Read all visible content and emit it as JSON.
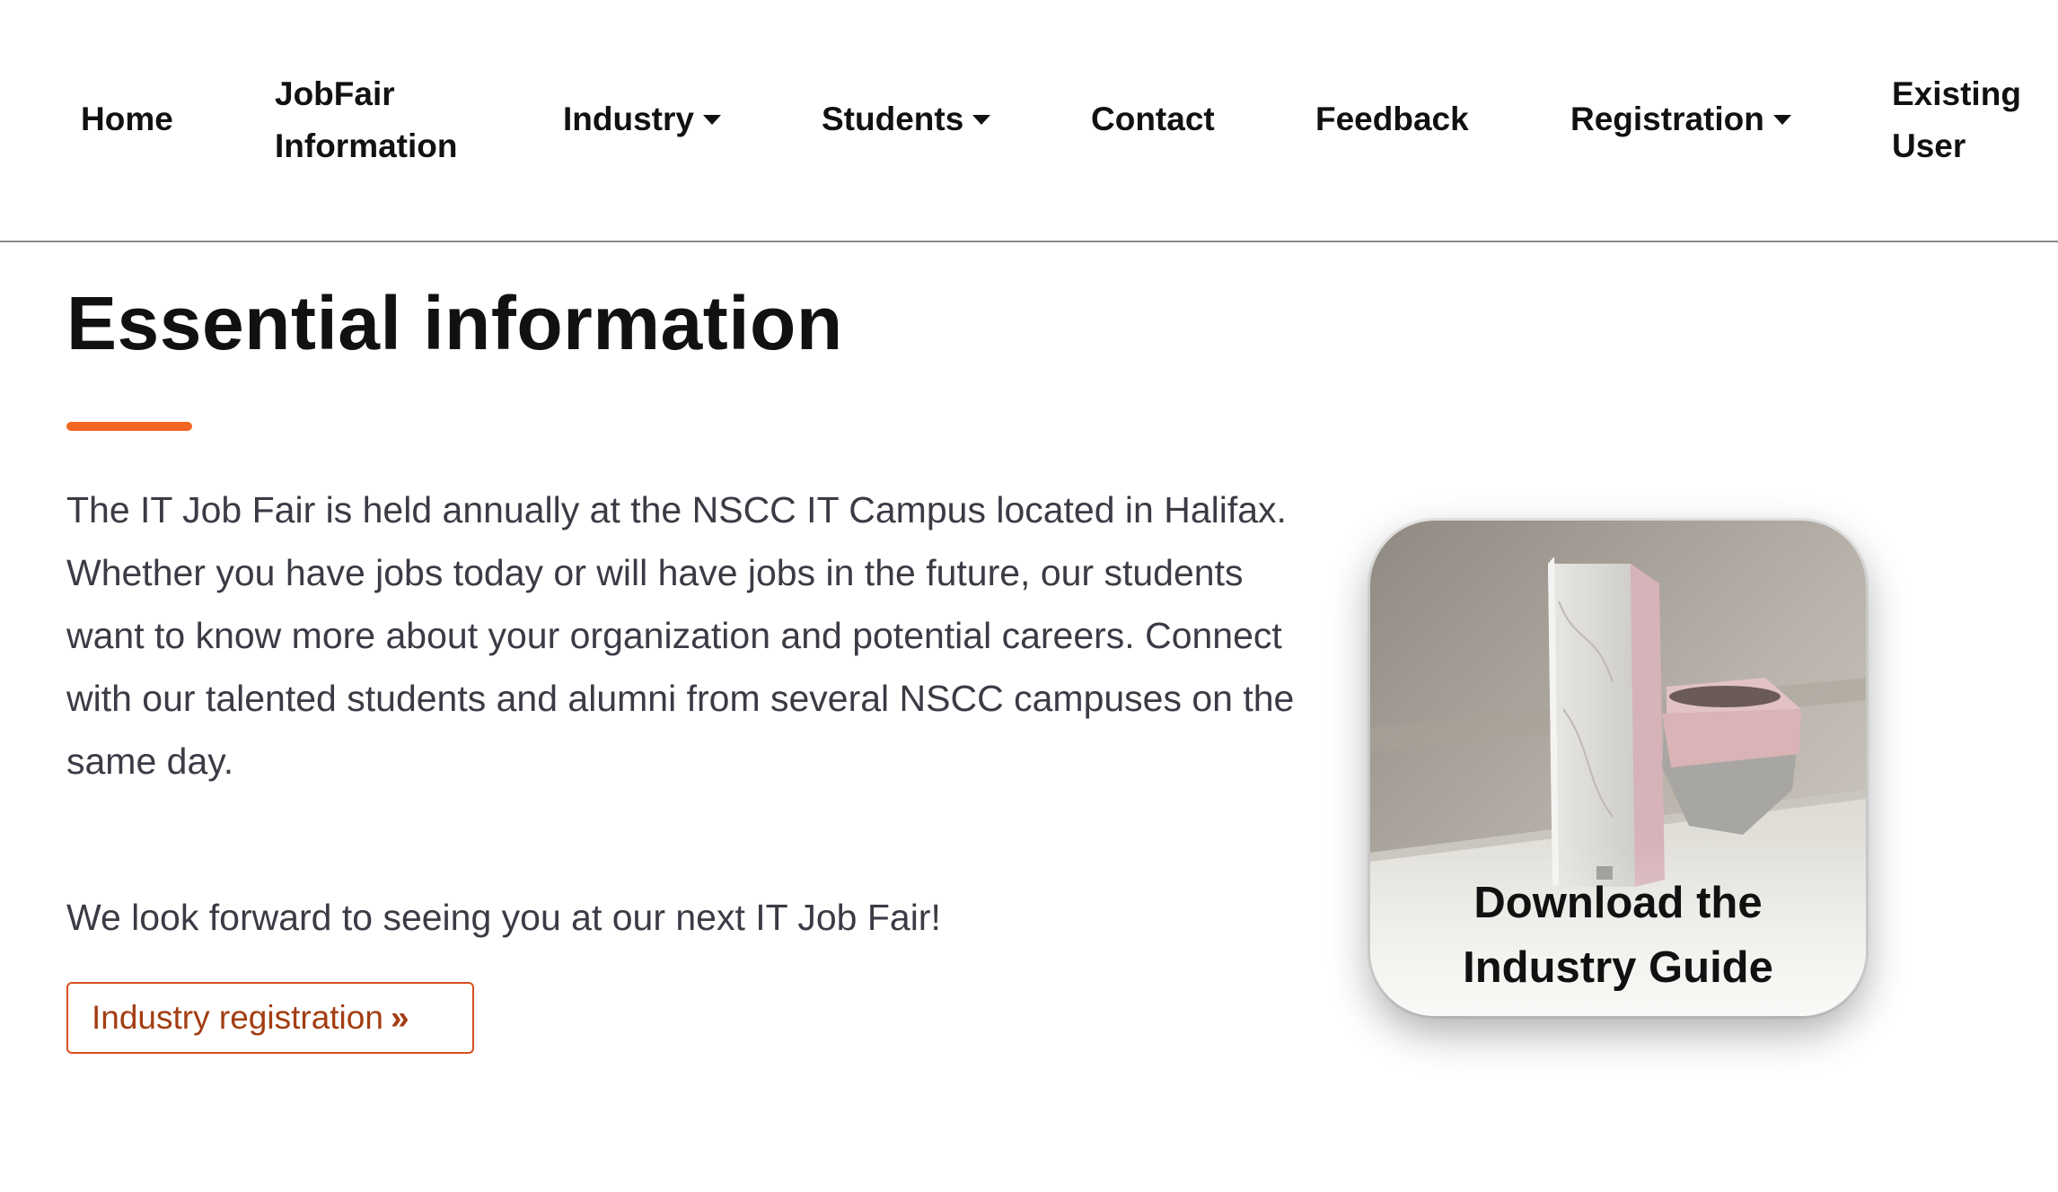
{
  "nav": {
    "home": "Home",
    "jobfair_line1": "JobFair",
    "jobfair_line2": "Information",
    "industry": "Industry",
    "students": "Students",
    "contact": "Contact",
    "feedback": "Feedback",
    "registration": "Registration",
    "existing_line1": "Existing",
    "existing_line2": "User"
  },
  "main": {
    "heading": "Essential information",
    "accent_color": "#f26522",
    "paragraph_1": "The IT Job Fair is held annually at the NSCC IT Campus located in Halifax. Whether you have jobs today or will have jobs in the future, our students want to know more about your organization and potential careers. Connect with our talented students and alumni from several NSCC campuses on the same day.",
    "paragraph_2": "We look forward to seeing you at our next IT Job Fair!",
    "registration_button": "Industry registration",
    "registration_button_icon": "double-chevron-right-icon"
  },
  "guide": {
    "line_1": "Download the",
    "line_2": "Industry Guide",
    "image_subject": "books-and-vase-photo"
  }
}
